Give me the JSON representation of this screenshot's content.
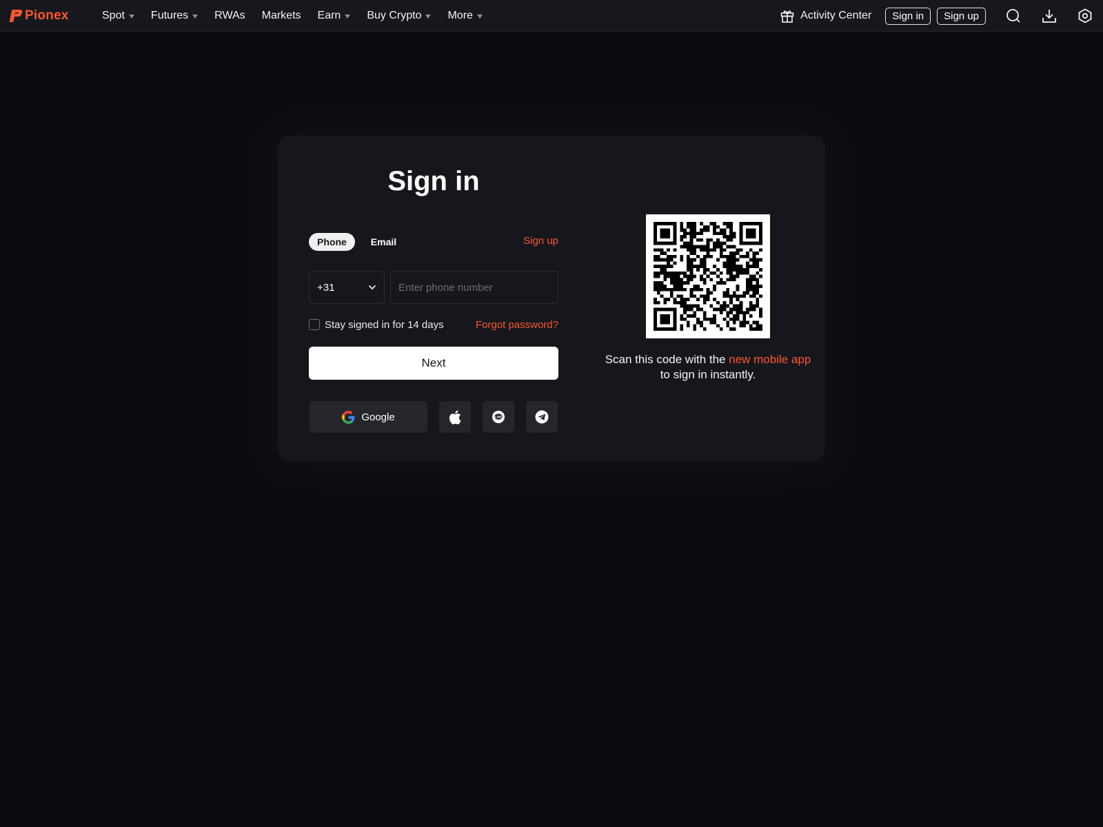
{
  "brand": {
    "name": "Pionex",
    "color": "#ff5630"
  },
  "nav": {
    "items": [
      {
        "label": "Spot",
        "dropdown": true
      },
      {
        "label": "Futures",
        "dropdown": true
      },
      {
        "label": "RWAs",
        "dropdown": false
      },
      {
        "label": "Markets",
        "dropdown": false
      },
      {
        "label": "Earn",
        "dropdown": true
      },
      {
        "label": "Buy Crypto",
        "dropdown": true
      },
      {
        "label": "More",
        "dropdown": true
      }
    ],
    "activity_center": "Activity Center",
    "sign_in": "Sign in",
    "sign_up": "Sign up",
    "icons": [
      "gift-icon",
      "search-icon",
      "download-icon",
      "settings-icon"
    ]
  },
  "login": {
    "title": "Sign in",
    "tabs": [
      "Phone",
      "Email"
    ],
    "active_tab": "Phone",
    "signup_link": "Sign up",
    "country_code": "+31",
    "phone_placeholder": "Enter phone number",
    "stay_signed_in": "Stay signed in for 14 days",
    "forgot_password": "Forgot password?",
    "next_button": "Next",
    "google_label": "Google",
    "social_icons": [
      "google-icon",
      "apple-icon",
      "line-icon",
      "telegram-icon"
    ]
  },
  "qr": {
    "text_prefix": "Scan this code with the ",
    "link_text": "new mobile app",
    "text_suffix": "to sign in instantly."
  }
}
